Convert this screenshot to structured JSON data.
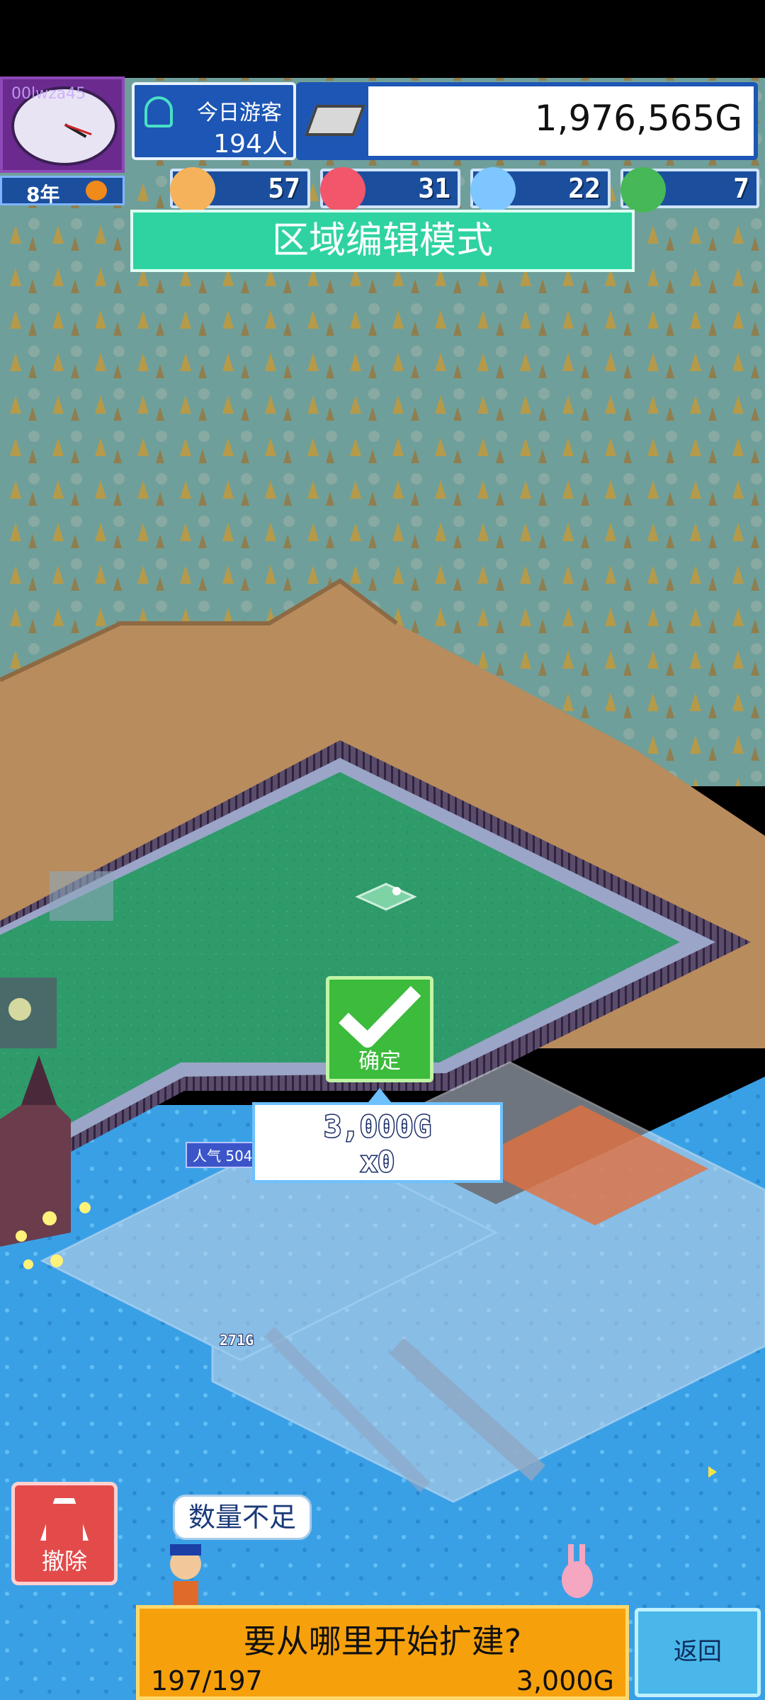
{
  "hud": {
    "clock_user_tag": "00lwza45",
    "year": "8年",
    "visitors_label": "今日游客",
    "visitors_count": "194人",
    "money": "1,976,565G",
    "stats": [
      {
        "icon": "happy-face-icon",
        "value": "57"
      },
      {
        "icon": "fire-icon",
        "value": "31"
      },
      {
        "icon": "water-drop-icon",
        "value": "22"
      },
      {
        "icon": "leaf-creature-icon",
        "value": "7"
      }
    ]
  },
  "mode_banner": "区域编辑模式",
  "confirm": {
    "label": "确定",
    "cost": "3,000G",
    "multiplier": "x0"
  },
  "map_labels": {
    "popularity": "人气 504",
    "price_tag": "271G"
  },
  "remove_button": "撤除",
  "shortage_bubble": "数量不足",
  "bottom": {
    "question": "要从哪里开始扩建?",
    "count": "197/197",
    "cost": "3,000G",
    "back_label": "返回"
  },
  "colors": {
    "banner": "#2fd3a1",
    "confirm": "#3cbb3c",
    "bottom_bar": "#f6a10c",
    "back_button": "#49b7ea",
    "remove_button": "#e34b4b",
    "hud_blue": "#1d56b4"
  }
}
